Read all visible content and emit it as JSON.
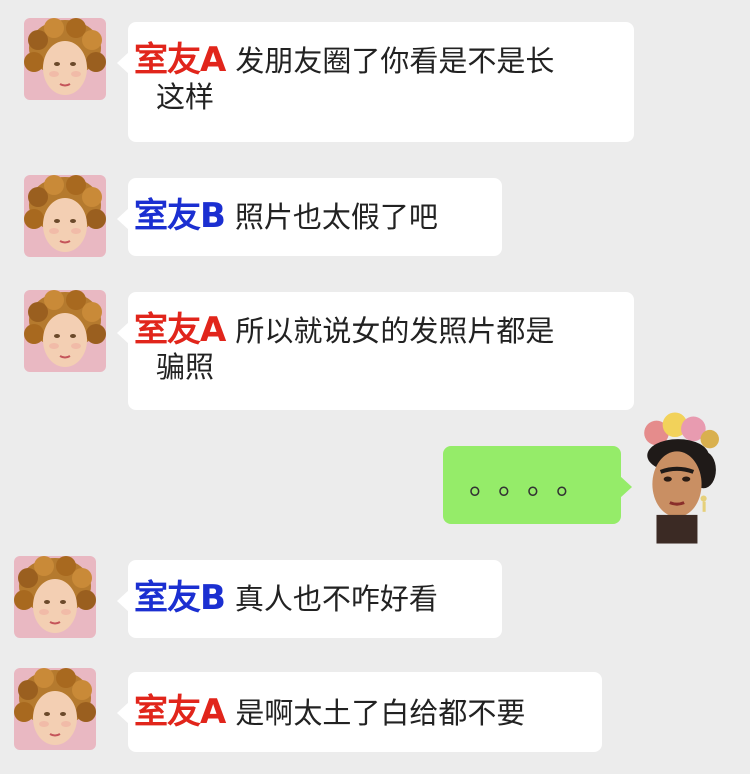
{
  "colors": {
    "background": "#ececec",
    "bubble_left": "#ffffff",
    "bubble_right": "#95ec69",
    "speaker_a": "#e1251b",
    "speaker_b": "#1b2fd1"
  },
  "messages": [
    {
      "speaker": "室友A",
      "line1": "发朋友圈了你看是不是长",
      "line2": "这样"
    },
    {
      "speaker": "室友B",
      "line1": "照片也太假了吧"
    },
    {
      "speaker": "室友A",
      "line1": "所以就说女的发照片都是",
      "line2": "骗照"
    },
    {
      "self_text": "。。。。"
    },
    {
      "speaker": "室友B",
      "line1": "真人也不咋好看"
    },
    {
      "speaker": "室友A",
      "line1": "是啊太土了白给都不要"
    }
  ],
  "icons": {
    "cherub": "cherub-avatar-icon",
    "frida": "frida-avatar-icon"
  }
}
